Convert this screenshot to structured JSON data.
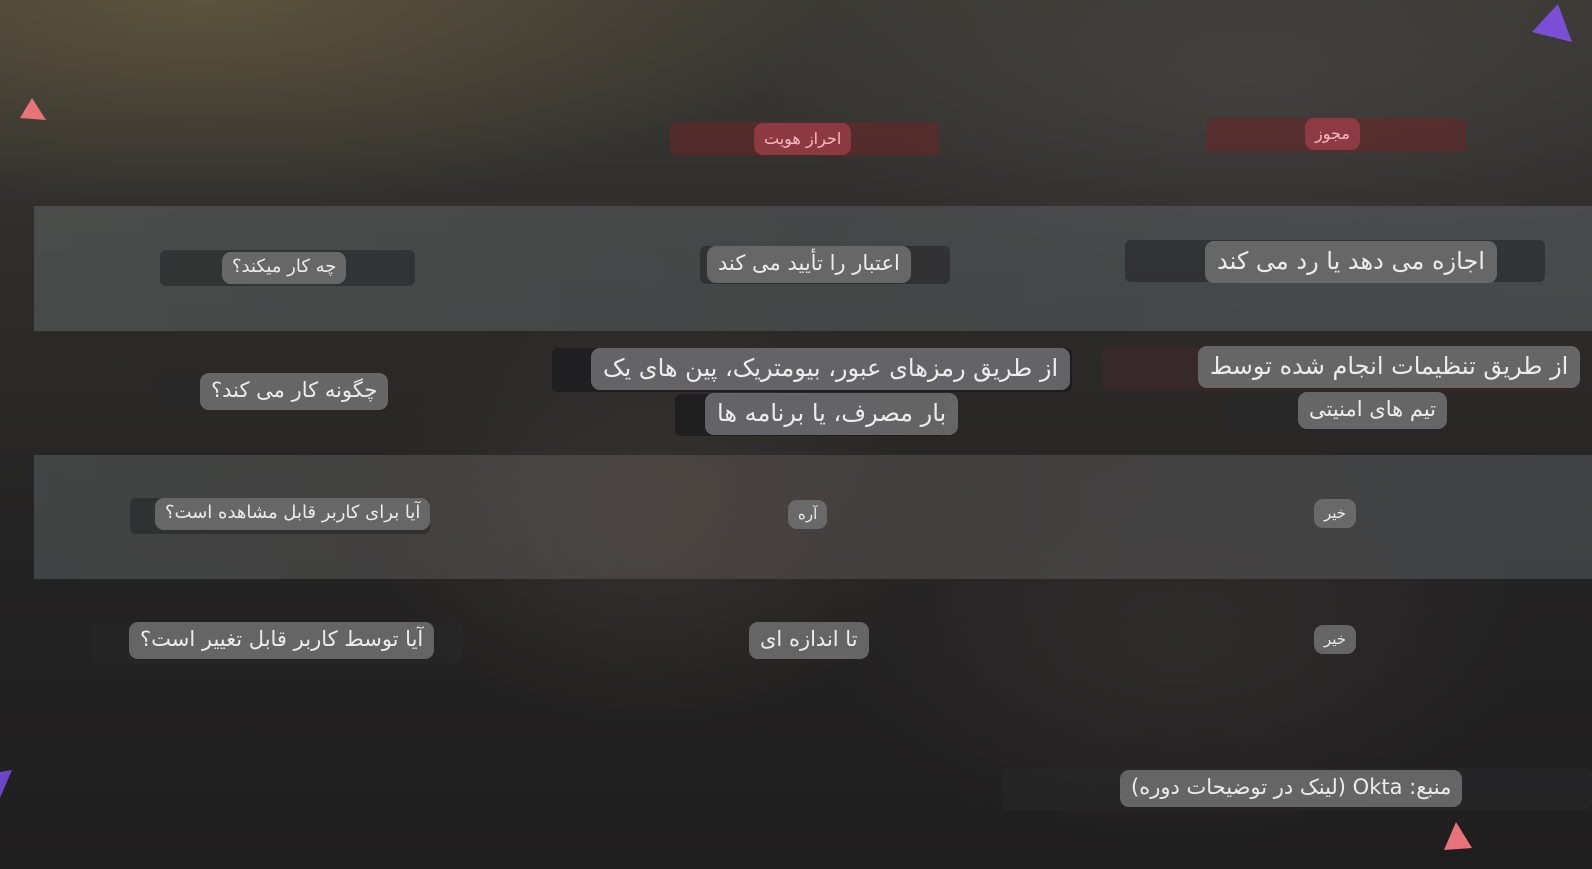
{
  "header": {
    "authentication": "احراز هویت",
    "authorization": "مجوز"
  },
  "rows": [
    {
      "question": "چه کار میکند؟",
      "authentication": "اعتبار را تأیید می کند",
      "authorization": "اجازه می دهد یا رد می کند"
    },
    {
      "question": "چگونه کار می کند؟",
      "authentication_line1": "از طریق رمزهای عبور، بیومتریک، پین های یک",
      "authentication_line2": "بار مصرف، یا برنامه ها",
      "authorization_line1": "از طریق تنظیمات انجام شده توسط",
      "authorization_line2": "تیم های امنیتی"
    },
    {
      "question": "آیا برای کاربر قابل مشاهده است؟",
      "authentication": "آره",
      "authorization": "خیر"
    },
    {
      "question": "آیا توسط کاربر قابل تغییر است؟",
      "authentication": "تا اندازه ای",
      "authorization": "خیر"
    }
  ],
  "source": "منبع: Okta (لینک در توضیحات دوره)",
  "colors": {
    "header_pill": "#963c46",
    "header_text": "#ffb7bf",
    "cell_pill": "#6e6e70",
    "decor_red": "#e8737a",
    "decor_purple": "#7a4fd6"
  },
  "decorations": [
    "triangle-red",
    "triangle-purple",
    "triangle-red",
    "triangle-purple"
  ]
}
